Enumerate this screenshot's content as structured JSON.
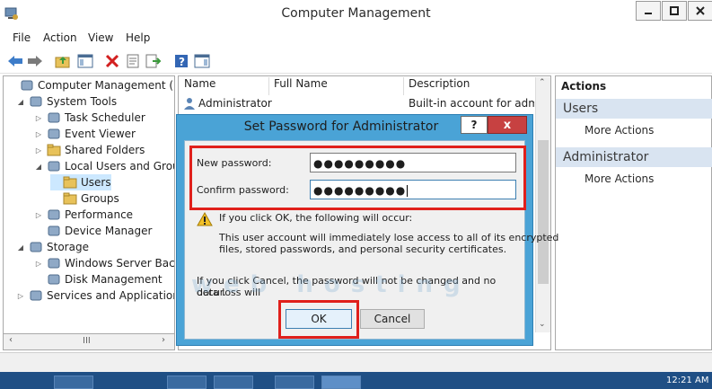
{
  "window": {
    "title": "Computer Management"
  },
  "menu": [
    "File",
    "Action",
    "View",
    "Help"
  ],
  "toolbar_icons": [
    "back-icon",
    "forward-icon",
    "up-folder-icon",
    "show-hide-tree-icon",
    "delete-icon",
    "properties-icon",
    "export-list-icon",
    "help-icon",
    "show-hide-action-pane-icon"
  ],
  "tree": [
    {
      "label": "Computer Management (Local",
      "depth": 0,
      "icon": "computer-management-icon",
      "expander": ""
    },
    {
      "label": "System Tools",
      "depth": 1,
      "icon": "tools-icon",
      "expander": "◢"
    },
    {
      "label": "Task Scheduler",
      "depth": 2,
      "icon": "clock-icon",
      "expander": "▷"
    },
    {
      "label": "Event Viewer",
      "depth": 2,
      "icon": "event-viewer-icon",
      "expander": "▷"
    },
    {
      "label": "Shared Folders",
      "depth": 2,
      "icon": "shared-folder-icon",
      "expander": "▷"
    },
    {
      "label": "Local Users and Groups",
      "depth": 2,
      "icon": "users-icon",
      "expander": "◢"
    },
    {
      "label": "Users",
      "depth": 3,
      "icon": "folder-icon",
      "expander": ""
    },
    {
      "label": "Groups",
      "depth": 3,
      "icon": "folder-icon",
      "expander": ""
    },
    {
      "label": "Performance",
      "depth": 2,
      "icon": "performance-icon",
      "expander": "▷"
    },
    {
      "label": "Device Manager",
      "depth": 2,
      "icon": "device-manager-icon",
      "expander": ""
    },
    {
      "label": "Storage",
      "depth": 1,
      "icon": "storage-icon",
      "expander": "◢"
    },
    {
      "label": "Windows Server Backup",
      "depth": 2,
      "icon": "backup-icon",
      "expander": "▷"
    },
    {
      "label": "Disk Management",
      "depth": 2,
      "icon": "disk-icon",
      "expander": ""
    },
    {
      "label": "Services and Applications",
      "depth": 1,
      "icon": "services-icon",
      "expander": "▷"
    }
  ],
  "list": {
    "columns": [
      "Name",
      "Full Name",
      "Description"
    ],
    "rows": [
      {
        "name": "Administrator",
        "full_name": "",
        "description": "Built-in account for admin"
      }
    ]
  },
  "actions": {
    "header": "Actions",
    "sections": [
      {
        "title": "Users",
        "links": [
          "More Actions"
        ]
      },
      {
        "title": "Administrator",
        "links": [
          "More Actions"
        ]
      }
    ]
  },
  "dialog": {
    "title": "Set Password for Administrator",
    "help_label": "?",
    "close_label": "x",
    "new_password_label": "New password:",
    "new_password_value": "●●●●●●●●●",
    "confirm_password_label": "Confirm password:",
    "confirm_password_value": "●●●●●●●●●",
    "warning_heading": "If you click OK, the following will occur:",
    "warning_line1": "This user account will immediately lose access to all of its encrypted",
    "warning_line2": "files, stored passwords, and personal security certificates.",
    "cancel_note_line1": "If you click Cancel, the password will not be changed and no data loss will",
    "cancel_note_line2": "occur.",
    "ok_label": "OK",
    "cancel_label": "Cancel"
  },
  "scrollbar_label": "III",
  "watermark": "web hosting",
  "clock": "12:21 AM",
  "colors": {
    "highlight": "#e0201b",
    "dialog_frame": "#4aa3d6",
    "actions_section": "#d9e4f1"
  }
}
